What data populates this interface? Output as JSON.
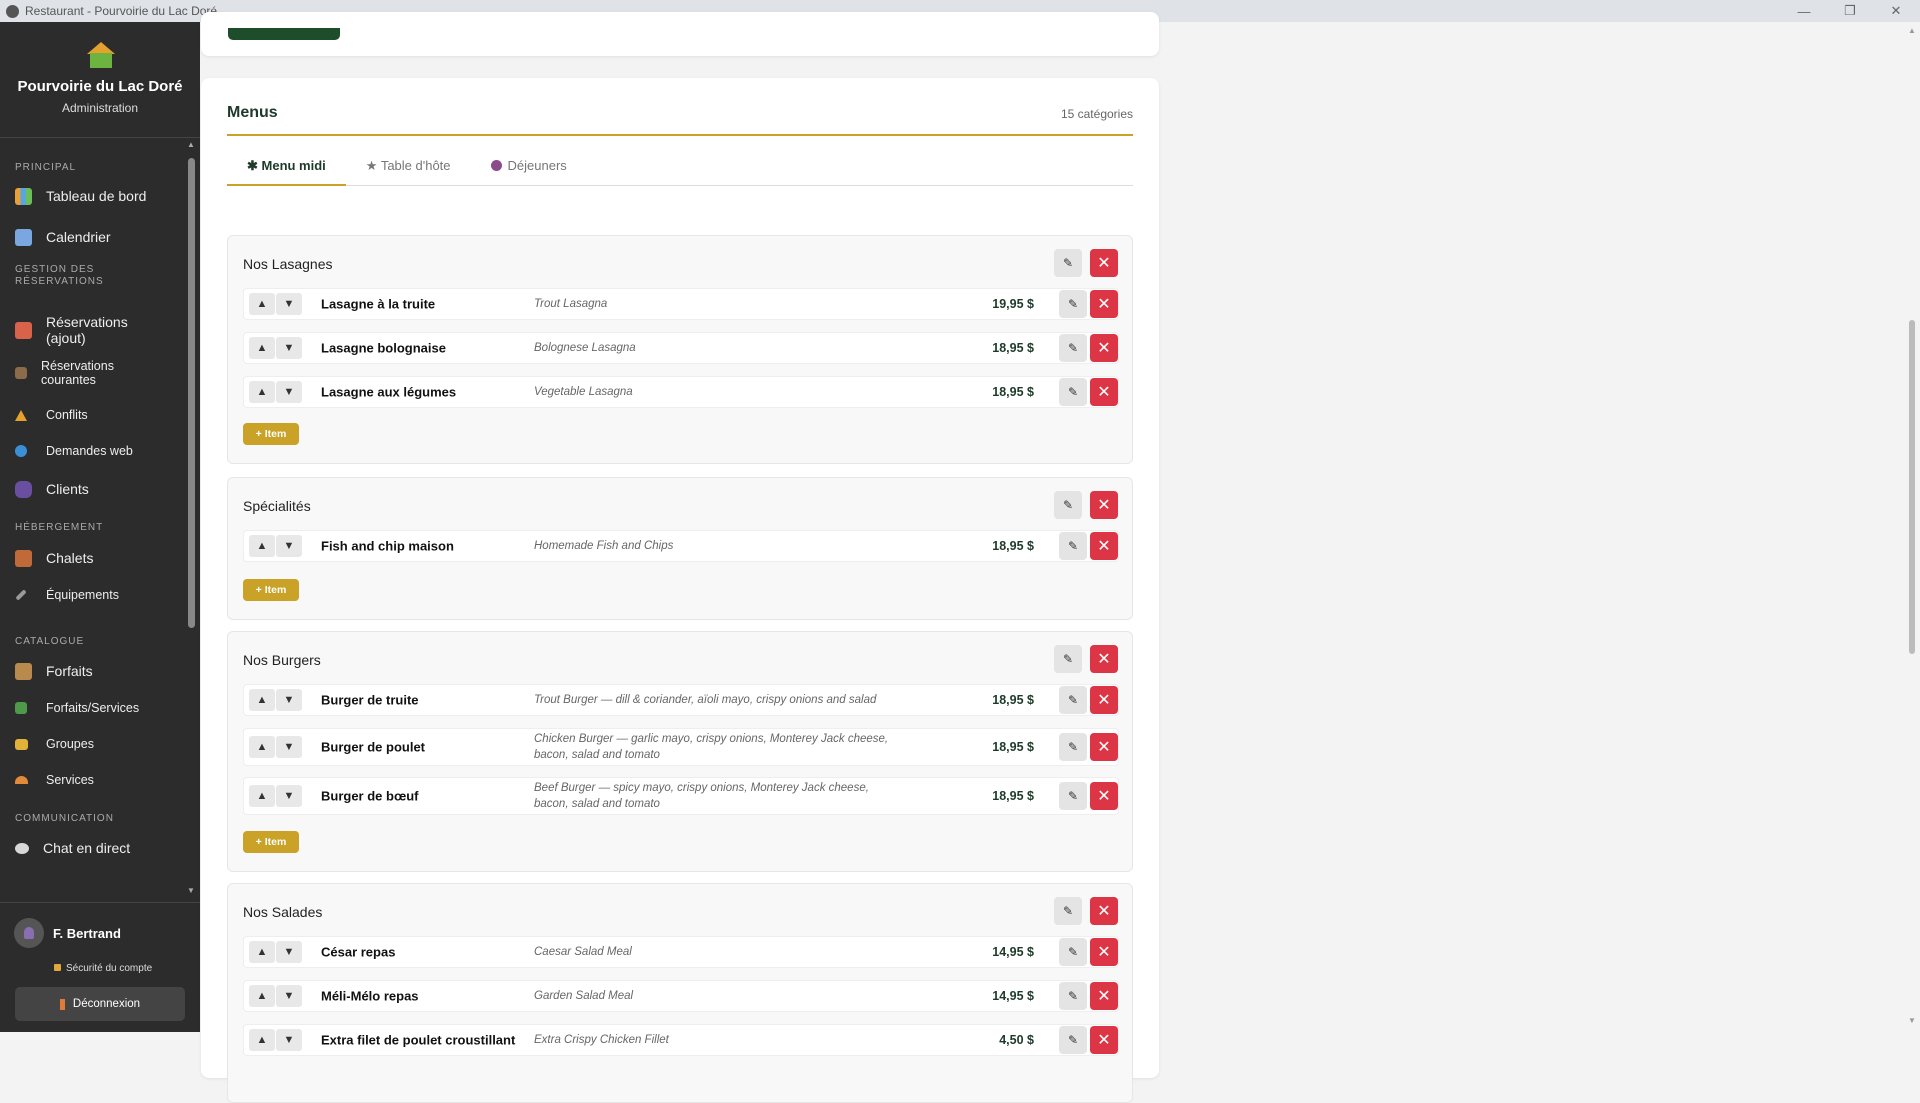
{
  "window": {
    "title": "Restaurant - Pourvoirie du Lac Doré",
    "minimize": "—",
    "restore": "❐",
    "close": "✕"
  },
  "brand": {
    "name": "Pourvoirie du Lac Doré",
    "subtitle": "Administration"
  },
  "nav": {
    "principal": "PRINCIPAL",
    "dashboard": "Tableau de bord",
    "calendar": "Calendrier",
    "gestion": "GESTION DES RÉSERVATIONS",
    "res_add": "Réservations (ajout)",
    "res_current": "Réservations courantes",
    "conflicts": "Conflits",
    "web": "Demandes web",
    "clients": "Clients",
    "hebergement": "HÉBERGEMENT",
    "chalets": "Chalets",
    "equipements": "Équipements",
    "catalogue": "CATALOGUE",
    "forfaits": "Forfaits",
    "forfaits_services": "Forfaits/Services",
    "groupes": "Groupes",
    "services": "Services",
    "communication": "COMMUNICATION",
    "chat": "Chat en direct"
  },
  "user": {
    "name": "F. Bertrand",
    "security": "Sécurité du compte",
    "logout": "Déconnexion"
  },
  "menus": {
    "title": "Menus",
    "count": "15 catégories",
    "tabs": [
      "✱ Menu midi",
      "★ Table d'hôte",
      "Déjeuners"
    ],
    "add_item": "+ Item",
    "categories": [
      {
        "name": "Nos Lasagnes",
        "items": [
          {
            "name": "Lasagne à la truite",
            "desc": "Trout Lasagna",
            "price": "19,95 $"
          },
          {
            "name": "Lasagne bolognaise",
            "desc": "Bolognese Lasagna",
            "price": "18,95 $"
          },
          {
            "name": "Lasagne aux légumes",
            "desc": "Vegetable Lasagna",
            "price": "18,95 $"
          }
        ]
      },
      {
        "name": "Spécialités",
        "items": [
          {
            "name": "Fish and chip maison",
            "desc": "Homemade Fish and Chips",
            "price": "18,95 $"
          }
        ]
      },
      {
        "name": "Nos Burgers",
        "items": [
          {
            "name": "Burger de truite",
            "desc": "Trout Burger — dill & coriander, aïoli mayo, crispy onions and salad",
            "price": "18,95 $"
          },
          {
            "name": "Burger de poulet",
            "desc": "Chicken Burger — garlic mayo, crispy onions, Monterey Jack cheese, bacon, salad and tomato",
            "price": "18,95 $"
          },
          {
            "name": "Burger de bœuf",
            "desc": "Beef Burger — spicy mayo, crispy onions, Monterey Jack cheese, bacon, salad and tomato",
            "price": "18,95 $"
          }
        ]
      },
      {
        "name": "Nos Salades",
        "items": [
          {
            "name": "César repas",
            "desc": "Caesar Salad Meal",
            "price": "14,95 $"
          },
          {
            "name": "Méli-Mélo repas",
            "desc": "Garden Salad Meal",
            "price": "14,95 $"
          },
          {
            "name": "Extra filet de poulet croustillant",
            "desc": "Extra Crispy Chicken Fillet",
            "price": "4,50 $"
          }
        ]
      }
    ]
  },
  "glyphs": {
    "up": "▲",
    "down": "▼",
    "edit": "✎",
    "delete": "✕"
  }
}
